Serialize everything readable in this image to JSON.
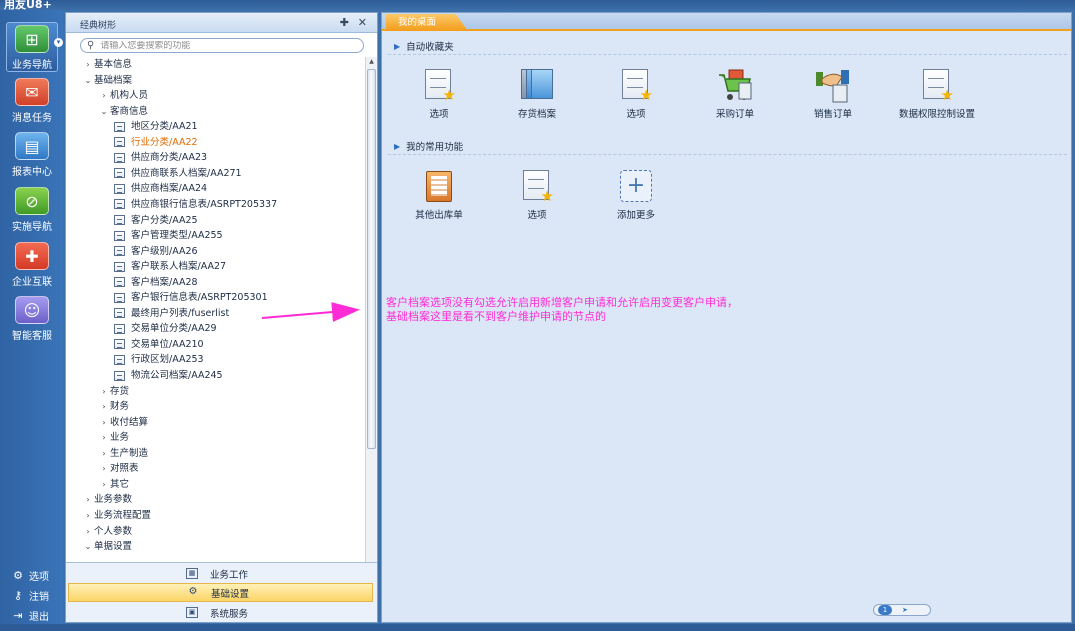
{
  "app": {
    "title": "用友U8+"
  },
  "leftnav": {
    "items": [
      {
        "label": "业务导航",
        "icon": "business-nav-icon",
        "color": "#3fa34d"
      },
      {
        "label": "消息任务",
        "icon": "message-icon",
        "color": "#e85b3a"
      },
      {
        "label": "报表中心",
        "icon": "report-icon",
        "color": "#3c8fd6"
      },
      {
        "label": "实施导航",
        "icon": "compass-icon",
        "color": "#5fb33a"
      },
      {
        "label": "企业互联",
        "icon": "connect-icon",
        "color": "#e84a35"
      },
      {
        "label": "智能客服",
        "icon": "chat-icon",
        "color": "#7a6fd0"
      }
    ],
    "bottom": [
      {
        "label": "选项",
        "icon": "gear-icon"
      },
      {
        "label": "注销",
        "icon": "key-icon"
      },
      {
        "label": "退出",
        "icon": "exit-icon"
      }
    ]
  },
  "tree": {
    "title": "经典树形",
    "search_placeholder": "请输入您要搜索的功能",
    "nodes": [
      {
        "label": "基本信息",
        "level": 0,
        "type": "collapsed"
      },
      {
        "label": "基础档案",
        "level": 0,
        "type": "expanded"
      },
      {
        "label": "机构人员",
        "level": 1,
        "type": "collapsed"
      },
      {
        "label": "客商信息",
        "level": 1,
        "type": "expanded"
      },
      {
        "label": "地区分类/AA21",
        "level": 2,
        "type": "leaf"
      },
      {
        "label": "行业分类/AA22",
        "level": 2,
        "type": "leaf",
        "highlight": true
      },
      {
        "label": "供应商分类/AA23",
        "level": 2,
        "type": "leaf"
      },
      {
        "label": "供应商联系人档案/AA271",
        "level": 2,
        "type": "leaf"
      },
      {
        "label": "供应商档案/AA24",
        "level": 2,
        "type": "leaf"
      },
      {
        "label": "供应商银行信息表/ASRPT205337",
        "level": 2,
        "type": "leaf"
      },
      {
        "label": "客户分类/AA25",
        "level": 2,
        "type": "leaf"
      },
      {
        "label": "客户管理类型/AA255",
        "level": 2,
        "type": "leaf"
      },
      {
        "label": "客户级别/AA26",
        "level": 2,
        "type": "leaf"
      },
      {
        "label": "客户联系人档案/AA27",
        "level": 2,
        "type": "leaf"
      },
      {
        "label": "客户档案/AA28",
        "level": 2,
        "type": "leaf"
      },
      {
        "label": "客户银行信息表/ASRPT205301",
        "level": 2,
        "type": "leaf"
      },
      {
        "label": "最终用户列表/fuserlist",
        "level": 2,
        "type": "leaf"
      },
      {
        "label": "交易单位分类/AA29",
        "level": 2,
        "type": "leaf"
      },
      {
        "label": "交易单位/AA210",
        "level": 2,
        "type": "leaf"
      },
      {
        "label": "行政区划/AA253",
        "level": 2,
        "type": "leaf"
      },
      {
        "label": "物流公司档案/AA245",
        "level": 2,
        "type": "leaf"
      },
      {
        "label": "存货",
        "level": 1,
        "type": "collapsed"
      },
      {
        "label": "财务",
        "level": 1,
        "type": "collapsed"
      },
      {
        "label": "收付结算",
        "level": 1,
        "type": "collapsed"
      },
      {
        "label": "业务",
        "level": 1,
        "type": "collapsed"
      },
      {
        "label": "生产制造",
        "level": 1,
        "type": "collapsed"
      },
      {
        "label": "对照表",
        "level": 1,
        "type": "collapsed"
      },
      {
        "label": "其它",
        "level": 1,
        "type": "collapsed"
      },
      {
        "label": "业务参数",
        "level": 0,
        "type": "collapsed"
      },
      {
        "label": "业务流程配置",
        "level": 0,
        "type": "collapsed"
      },
      {
        "label": "个人参数",
        "level": 0,
        "type": "collapsed"
      },
      {
        "label": "单据设置",
        "level": 0,
        "type": "expanded"
      }
    ],
    "bottom_tabs": [
      {
        "label": "业务工作",
        "icon": "work-icon",
        "active": false
      },
      {
        "label": "基础设置",
        "icon": "settings-icon",
        "active": true
      },
      {
        "label": "系统服务",
        "icon": "service-icon",
        "active": false
      }
    ]
  },
  "main": {
    "tab": "我的桌面",
    "section_favorites": "自动收藏夹",
    "favorites": [
      {
        "label": "选项",
        "icon": "doc-star-icon"
      },
      {
        "label": "存货档案",
        "icon": "books-icon"
      },
      {
        "label": "选项",
        "icon": "doc-star-icon"
      },
      {
        "label": "采购订单",
        "icon": "cart-icon"
      },
      {
        "label": "销售订单",
        "icon": "handshake-icon"
      },
      {
        "label": "数据权限控制设置",
        "icon": "doc-star-icon"
      }
    ],
    "section_common": "我的常用功能",
    "common": [
      {
        "label": "其他出库单",
        "icon": "clipboard-icon"
      },
      {
        "label": "选项",
        "icon": "doc-star-icon"
      },
      {
        "label": "添加更多",
        "icon": "add-icon"
      }
    ],
    "note_line1": "客户档案选项没有勾选允许启用新增客户申请和允许启用变更客户申请，",
    "note_line2": "基础档案这里是看不到客户维护申请的节点的",
    "pager": "1"
  },
  "colors": {
    "annotation": "#ff2bd6",
    "accent_tab": "#f39c1a",
    "highlight_node": "#e06a00"
  }
}
